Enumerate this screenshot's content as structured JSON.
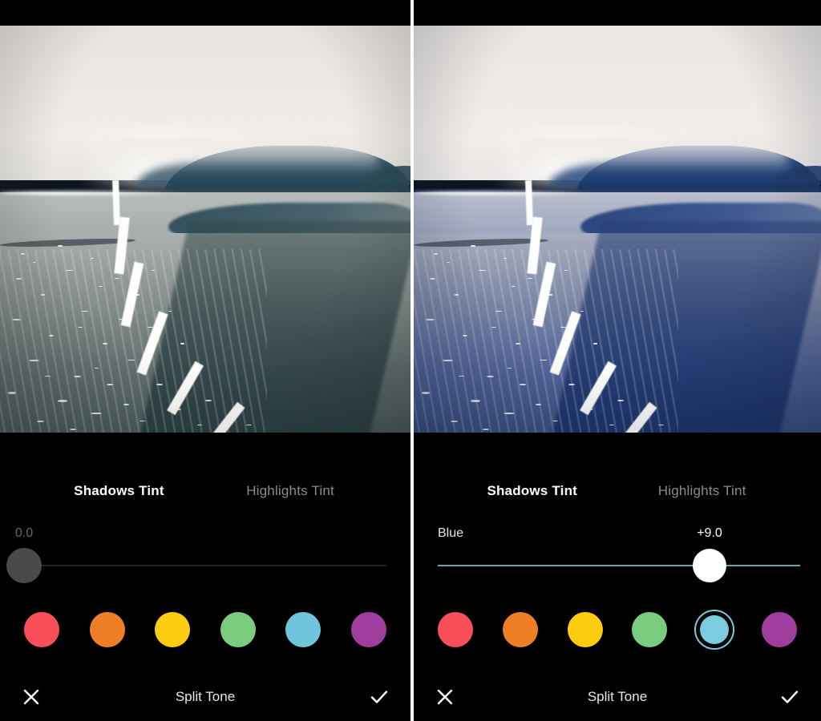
{
  "app": {
    "screen_title": "Split Tone",
    "panels": [
      {
        "id": "before",
        "tabs": [
          {
            "label": "Shadows Tint",
            "active": true
          },
          {
            "label": "Highlights Tint",
            "active": false
          }
        ],
        "slider": {
          "label": "",
          "value": "0.0",
          "position_pct": 0,
          "handle_color": "#4a4a4a",
          "track_color": "#232323",
          "value_color": "#666666"
        },
        "swatches": [
          {
            "name": "red",
            "color": "#f8505a",
            "selected": false
          },
          {
            "name": "orange",
            "color": "#ef7f26",
            "selected": false
          },
          {
            "name": "yellow",
            "color": "#fbcc10",
            "selected": false
          },
          {
            "name": "green",
            "color": "#79cc7e",
            "selected": false
          },
          {
            "name": "blue",
            "color": "#6fc6dc",
            "selected": false
          },
          {
            "name": "purple",
            "color": "#a03c9b",
            "selected": false
          }
        ],
        "bottom": {
          "cancel": "close-icon",
          "title": "Split Tone",
          "confirm": "check-icon"
        }
      },
      {
        "id": "after",
        "tabs": [
          {
            "label": "Shadows Tint",
            "active": true
          },
          {
            "label": "Highlights Tint",
            "active": false
          }
        ],
        "slider": {
          "label": "Blue",
          "value": "+9.0",
          "position_pct": 75,
          "handle_color": "#ffffff",
          "track_color": "#6fa3b4",
          "value_color": "#ffffff"
        },
        "swatches": [
          {
            "name": "red",
            "color": "#f8505a",
            "selected": false
          },
          {
            "name": "orange",
            "color": "#ef7f26",
            "selected": false
          },
          {
            "name": "yellow",
            "color": "#fbcc10",
            "selected": false
          },
          {
            "name": "green",
            "color": "#79cc7e",
            "selected": false
          },
          {
            "name": "blue",
            "color": "#7dcbdf",
            "selected": true
          },
          {
            "name": "purple",
            "color": "#a03c9b",
            "selected": false
          }
        ],
        "bottom": {
          "cancel": "close-icon",
          "title": "Split Tone",
          "confirm": "check-icon"
        }
      }
    ],
    "photo": {
      "subject": "beach shoreline with distant headland",
      "before_palette": {
        "sky_top": "#e9e4df",
        "sky_bottom": "#f0ece7",
        "hill": "#2b4a5c",
        "water": "#9aa3a3",
        "sand": "#8e9793",
        "wet_sand": "#5d6b6c",
        "foam": "#fdfdfb"
      },
      "after_palette": {
        "sky_top": "#ece7e2",
        "sky_bottom": "#f1ece8",
        "hill": "#1e3f70",
        "water": "#8e9bb4",
        "sand": "#8992a8",
        "wet_sand": "#3a5080",
        "foam": "#fdfdfb"
      }
    },
    "colors": {
      "background": "#000000",
      "active_tab": "#ffffff",
      "inactive_tab": "#8c8c8c",
      "divider": "#ffffff"
    }
  }
}
